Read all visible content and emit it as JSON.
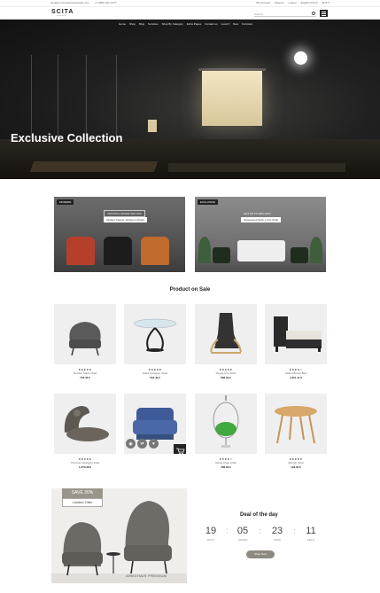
{
  "topbar": {
    "email": "info@yourcompanyexample.com",
    "phone": "+1 (000) 421-1277",
    "links": [
      "My Account",
      "Support",
      "Logout",
      "English (US) ▾",
      "$US ▾"
    ]
  },
  "header": {
    "logo": "SCITA",
    "logo_sub": "home decor",
    "search_placeholder": "Search..."
  },
  "nav": {
    "items": [
      "Home",
      "Shop",
      "Blog",
      "Services",
      "Shop By Category",
      "Extra Pages",
      "Contact us",
      "Level ▾",
      "New",
      "Furniture"
    ]
  },
  "hero": {
    "title": "Exclusive Collection"
  },
  "banners": [
    {
      "tag": "MODERN",
      "offer": "FESTIVAL OFFER 50% OFF",
      "subtitle": "Modern Interior 10 Room Chairs"
    },
    {
      "tag": "EXCLUSIVE",
      "offer": "GET UP TO 45% OFF*",
      "subtitle": "Greenwood Sofa + Arm Chair"
    }
  ],
  "section": {
    "title": "Product on Sale"
  },
  "products": [
    {
      "name": "Scarlett Stack Chair",
      "price": "718.40 €",
      "stars": "★★★★★",
      "icon": "armchair-icon"
    },
    {
      "name": "Glass Designer Chair",
      "price": "591.40 €",
      "stars": "★★★★★",
      "icon": "glass-table-icon"
    },
    {
      "name": "Poang Arm Chair",
      "price": "883.20 €",
      "stars": "★★★★★",
      "icon": "lounge-chair-icon"
    },
    {
      "name": "Patriot Brown Bed",
      "price": "1,651.11 €",
      "stars": "★★★★☆",
      "icon": "bed-icon"
    },
    {
      "name": "Premium Designer Sofa",
      "price": "1,370.38 €",
      "stars": "★★★★★",
      "icon": "curved-sofa-icon"
    },
    {
      "name": "",
      "price": "",
      "stars": "",
      "icon": "blue-armchair-icon"
    },
    {
      "name": "Swing Cane Chair",
      "price": "458.94 €",
      "stars": "★★★★☆",
      "icon": "swing-chair-icon"
    },
    {
      "name": "Varnish Stool",
      "price": "194.02 €",
      "stars": "★★★★★",
      "icon": "stool-icon"
    }
  ],
  "deal": {
    "save": "SAVE 30%",
    "limited": "Limited Offer",
    "caption": "ARMCHAIR PREMIUM",
    "title": "Deal of the day",
    "countdown": [
      {
        "value": "19",
        "label": "DAYS"
      },
      {
        "value": "05",
        "label": "HOURS"
      },
      {
        "value": "23",
        "label": "MINS"
      },
      {
        "value": "11",
        "label": "SECS"
      }
    ],
    "button": "Shop Now"
  },
  "colors": {
    "dark": "#222222",
    "accent": "#8e8a81",
    "badge": "#999588"
  }
}
